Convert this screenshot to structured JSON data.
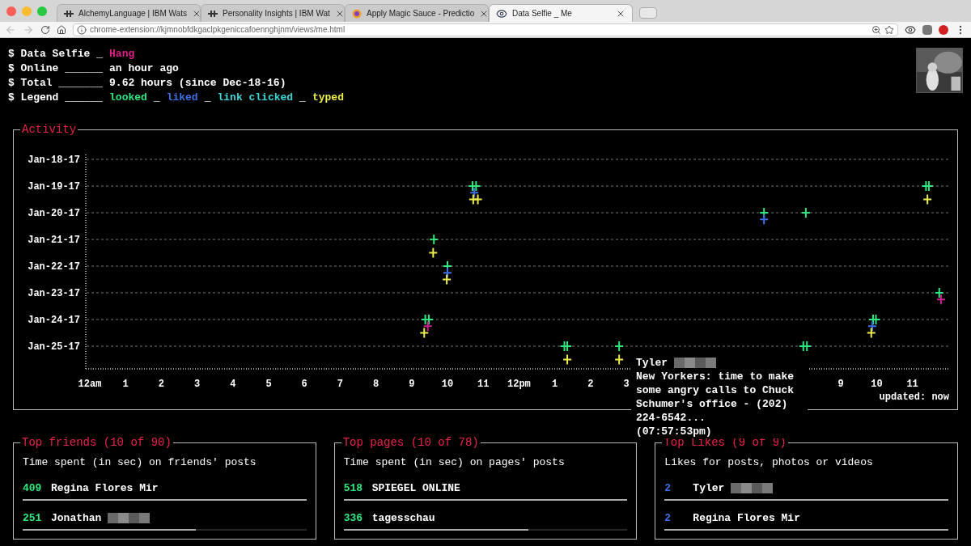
{
  "browser": {
    "tabs": [
      {
        "title": "AlchemyLanguage | IBM Wats",
        "selected": false
      },
      {
        "title": "Personality Insights | IBM Wat",
        "selected": false
      },
      {
        "title": "Apply Magic Sauce - Predictio",
        "selected": false
      },
      {
        "title": "Data Selfie _ Me",
        "selected": true
      }
    ],
    "url": "chrome-extension://kjmnobfdkgaclpkgeniccafoennghjnm/views/me.html"
  },
  "summary": {
    "title_label": "$ Data Selfie _",
    "user": "Hang",
    "online_label": "$ Online ______",
    "online": "an hour ago",
    "total_label": "$ Total _______",
    "total": "9.62 hours (since Dec-18-16)",
    "legend_label": "$ Legend ______",
    "legend": [
      {
        "name": "looked",
        "color": "#2ee87e",
        "separator": "_"
      },
      {
        "name": "liked",
        "color": "#3d6fe6",
        "separator": "_"
      },
      {
        "name": "link clicked",
        "color": "#3fd6d6",
        "separator": "_"
      },
      {
        "name": "typed",
        "color": "#ecec4c"
      }
    ]
  },
  "activity": {
    "title": "Activity",
    "updated": "updated: now",
    "x_labels_am": [
      "12am",
      "1",
      "2",
      "3",
      "4",
      "5",
      "6",
      "7",
      "8",
      "9",
      "10",
      "11"
    ],
    "x_labels_pm": [
      "12pm",
      "1",
      "2",
      "3"
    ],
    "x_labels_late": [
      "9",
      "10",
      "11"
    ],
    "y_labels": [
      "Jan-18-17",
      "Jan-19-17",
      "Jan-20-17",
      "Jan-21-17",
      "Jan-22-17",
      "Jan-23-17",
      "Jan-24-17",
      "Jan-25-17"
    ],
    "tooltip": {
      "name": "Tyler",
      "text": "New Yorkers: time to make some angry calls to Chuck Schumer's office - (202) 224-6542...",
      "time": "(07:57:53pm)"
    }
  },
  "panels": [
    {
      "title": "Top friends (10 of 90)",
      "subtitle": "Time spent (in sec) on friends' posts",
      "rows": [
        {
          "count": "409",
          "name": "Regina Flores Mir",
          "blurred": false,
          "level": 1
        },
        {
          "count": "251",
          "name": "Jonathan",
          "blurred": true,
          "level": 0.61
        }
      ]
    },
    {
      "title": "Top pages (10 of 78)",
      "subtitle": "Time spent (in sec) on pages' posts",
      "rows": [
        {
          "count": "518",
          "name": "SPIEGEL ONLINE",
          "blurred": false,
          "level": 1
        },
        {
          "count": "336",
          "name": "tagesschau",
          "blurred": false,
          "level": 0.65
        }
      ]
    },
    {
      "title": "Top Likes (9 of 9)",
      "subtitle": "Likes for posts, photos or videos",
      "rows": [
        {
          "count": "2",
          "name": "Tyler",
          "blurred": true,
          "level": 1
        },
        {
          "count": "2",
          "name": "Regina Flores Mir",
          "blurred": false,
          "level": 1
        }
      ]
    }
  ]
}
